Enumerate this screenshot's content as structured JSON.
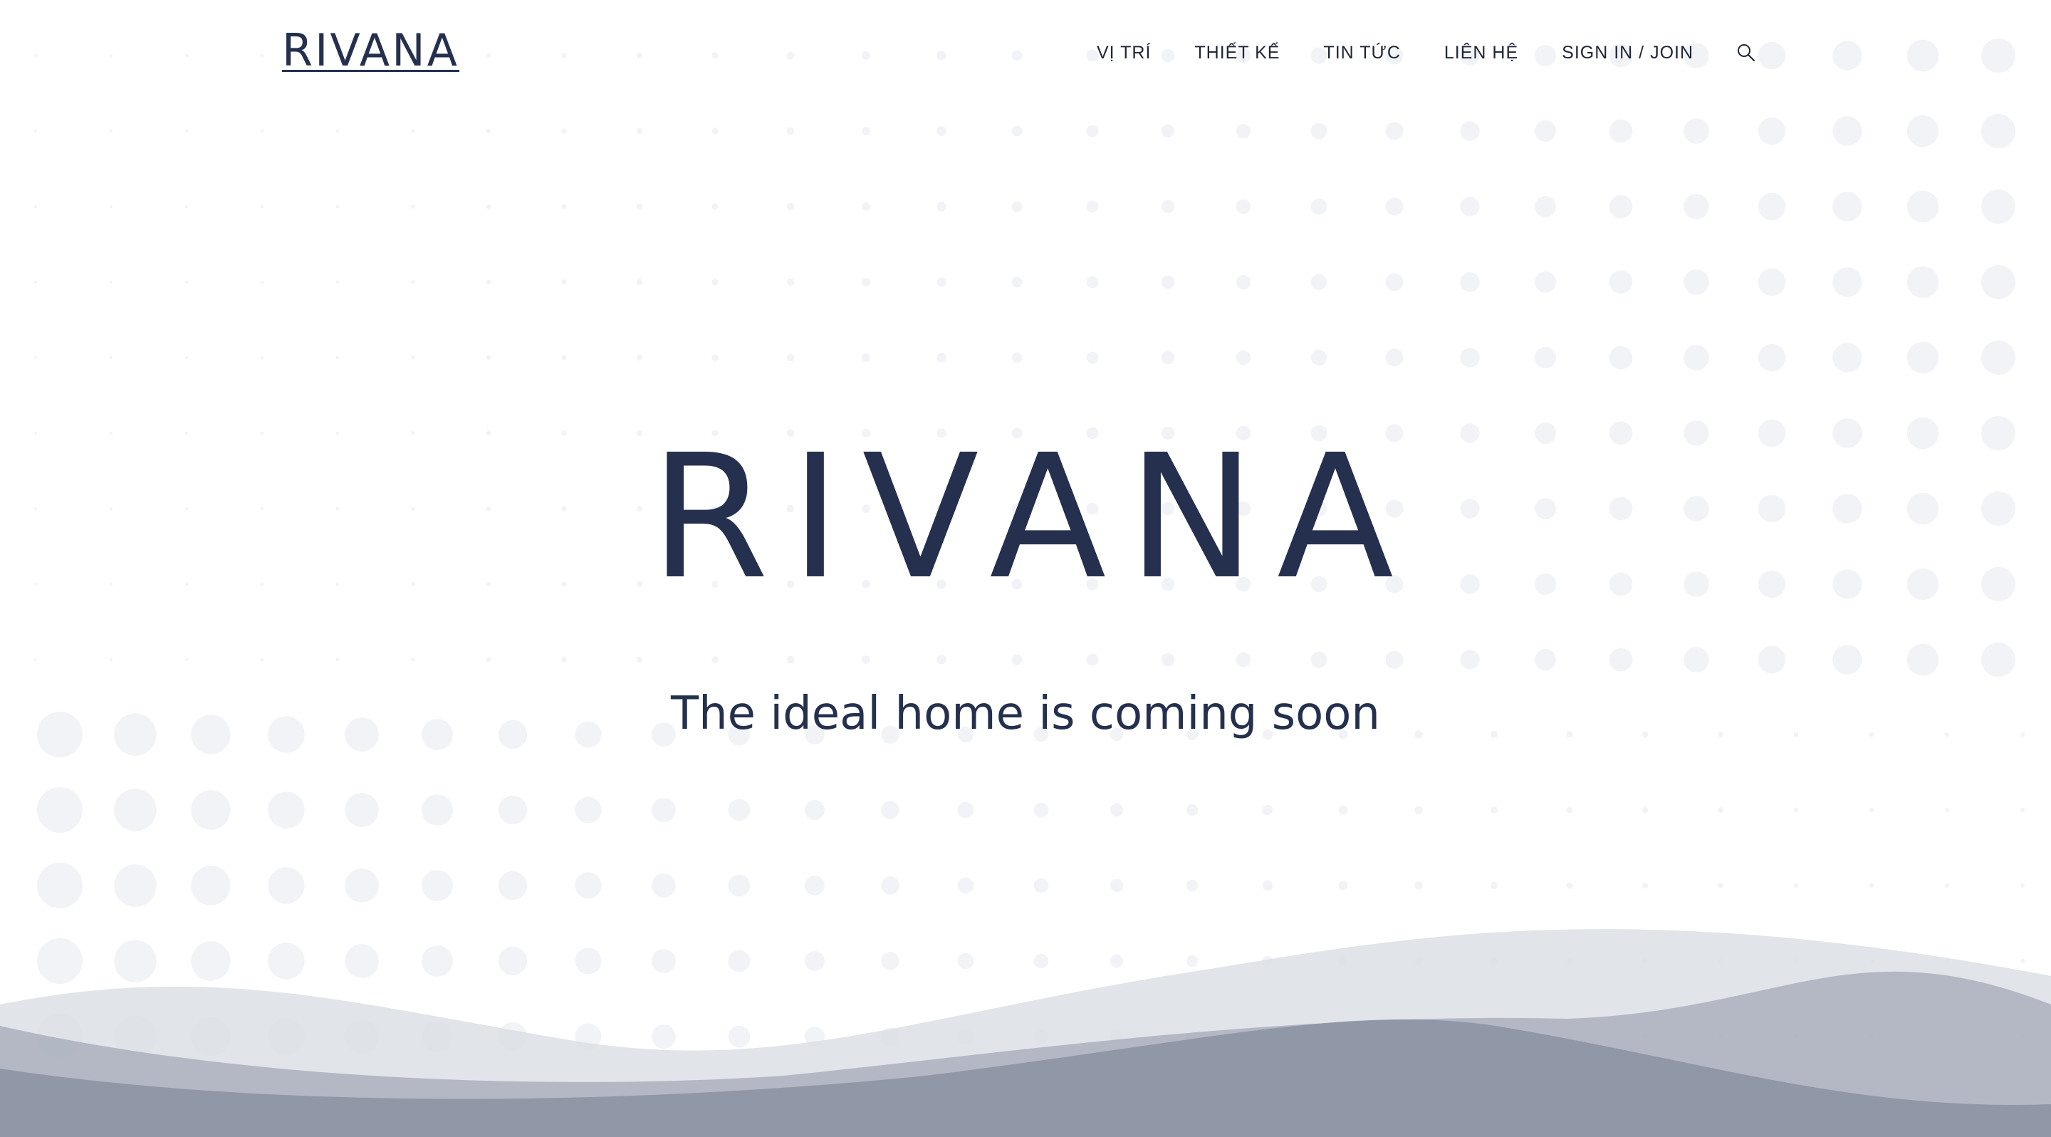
{
  "header": {
    "logo": "RIVANA",
    "nav": [
      {
        "label": "VỊ TRÍ"
      },
      {
        "label": "THIẾT KẾ"
      },
      {
        "label": "TIN TỨC"
      },
      {
        "label": "LIÊN HỆ"
      },
      {
        "label": "SIGN IN / JOIN"
      }
    ],
    "search_icon": "search-icon"
  },
  "hero": {
    "title": "RIVANA",
    "subtitle": "The ideal home is coming soon"
  },
  "colors": {
    "text": "#24304d",
    "dot": "#f1f2f5",
    "wave_light": "#dcdfe6",
    "wave_mid": "#a9afbd",
    "wave_dark": "#8a90a2"
  }
}
